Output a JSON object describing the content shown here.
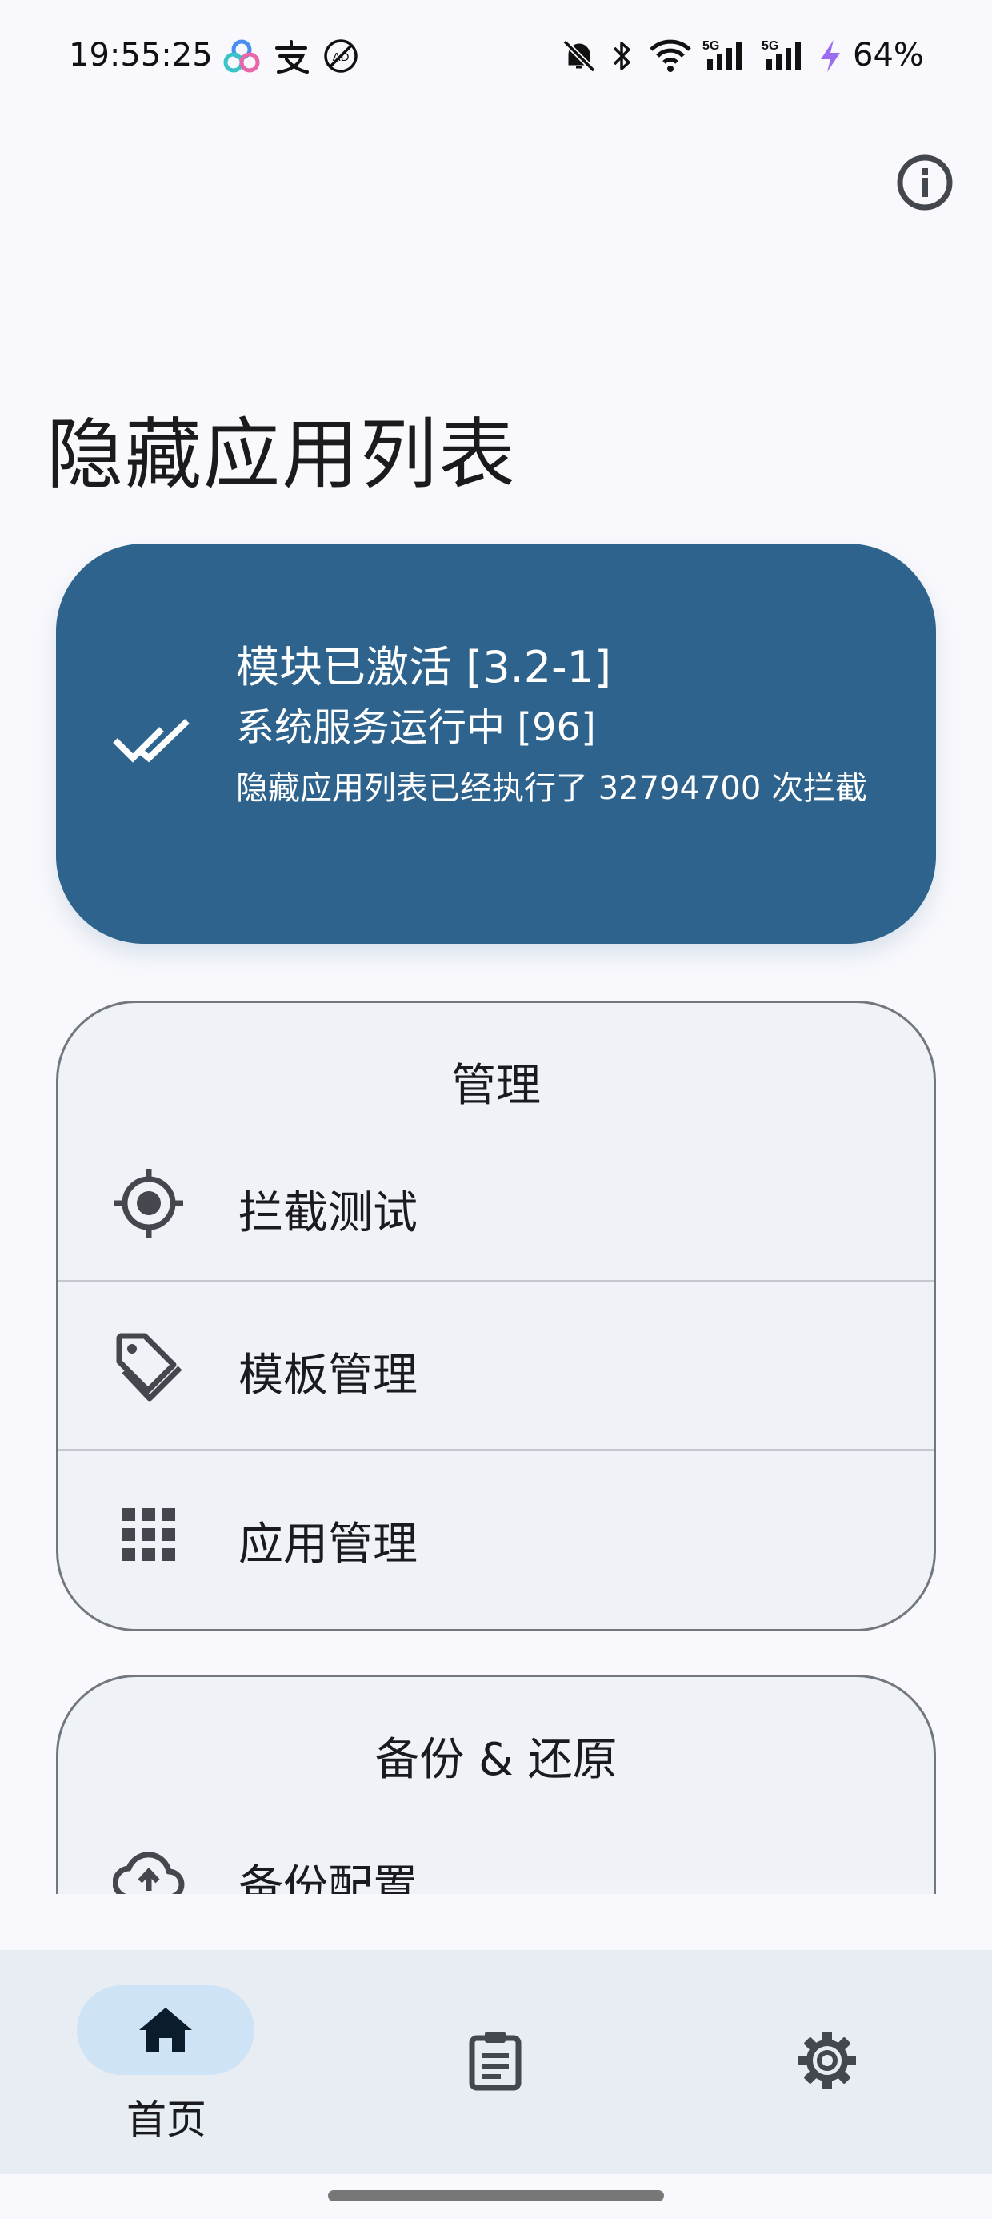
{
  "status_bar": {
    "time": "19:55:25",
    "notification_icons": [
      "cloud-app-icon",
      "alipay-icon",
      "no-ads-icon"
    ],
    "system_icons": [
      "mute-bell-icon",
      "bluetooth-icon",
      "wifi-icon",
      "signal-5g-icon",
      "signal-5g-icon",
      "charging-icon"
    ],
    "battery": "64%"
  },
  "header": {
    "info_icon": "info-icon",
    "title": "隐藏应用列表"
  },
  "status_card": {
    "icon": "double-check-icon",
    "title": "模块已激活 [3.2-1]",
    "subtitle": "系统服务运行中 [96]",
    "description": "隐藏应用列表已经执行了 32794700 次拦截",
    "color": "#2d638c"
  },
  "manage": {
    "title": "管理",
    "items": [
      {
        "icon": "target-icon",
        "label": "拦截测试"
      },
      {
        "icon": "tag-icon",
        "label": "模板管理"
      },
      {
        "icon": "apps-grid-icon",
        "label": "应用管理"
      }
    ]
  },
  "backup": {
    "title": "备份 & 还原",
    "items": [
      {
        "icon": "cloud-upload-icon",
        "label": "备份配置"
      }
    ]
  },
  "bottom_nav": {
    "items": [
      {
        "icon": "home-icon",
        "label": "首页",
        "selected": true
      },
      {
        "icon": "clipboard-icon",
        "label": "",
        "selected": false
      },
      {
        "icon": "gear-icon",
        "label": "",
        "selected": false
      }
    ],
    "accent": "#cee3f6"
  }
}
